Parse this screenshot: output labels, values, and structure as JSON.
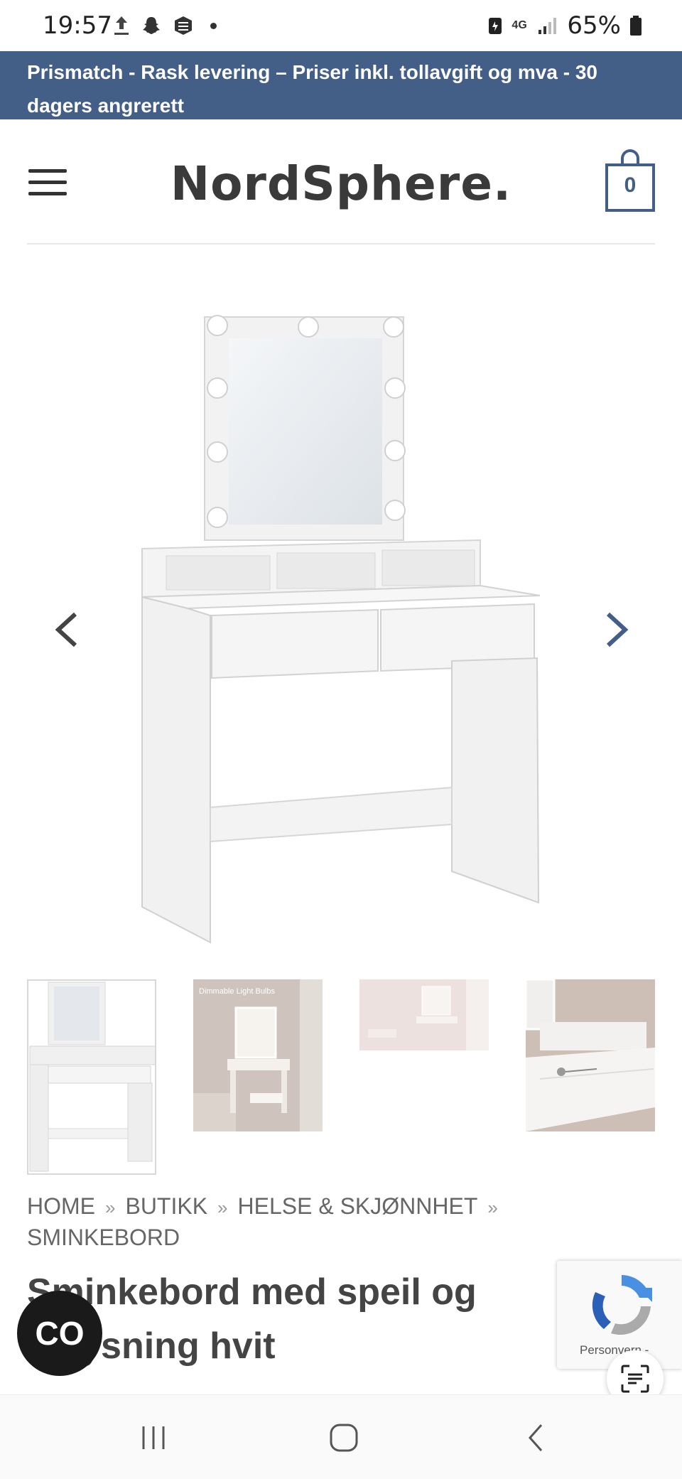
{
  "status_bar": {
    "time": "19:57",
    "network": "4G",
    "battery": "65%"
  },
  "promo": {
    "text": "Prismatch - Rask levering – Priser inkl. tollavgift og mva - 30 dagers angrerett"
  },
  "header": {
    "logo": "NordSphere.",
    "cart_count": "0"
  },
  "gallery": {
    "thumbnails": [
      {
        "caption": ""
      },
      {
        "caption": "Dimmable Light Bulbs"
      },
      {
        "caption": ""
      },
      {
        "caption": ""
      }
    ]
  },
  "breadcrumb": {
    "items": [
      "HOME",
      "BUTIKK",
      "HELSE & SKJØNNHET",
      "SMINKEBORD"
    ],
    "separator": "»"
  },
  "product": {
    "title": "Sminkebord med speil og belysning hvit"
  },
  "chat": {
    "label": "CO"
  },
  "recaptcha": {
    "label": "Personvern -"
  },
  "colors": {
    "brand": "#435f87",
    "text": "#444444"
  }
}
